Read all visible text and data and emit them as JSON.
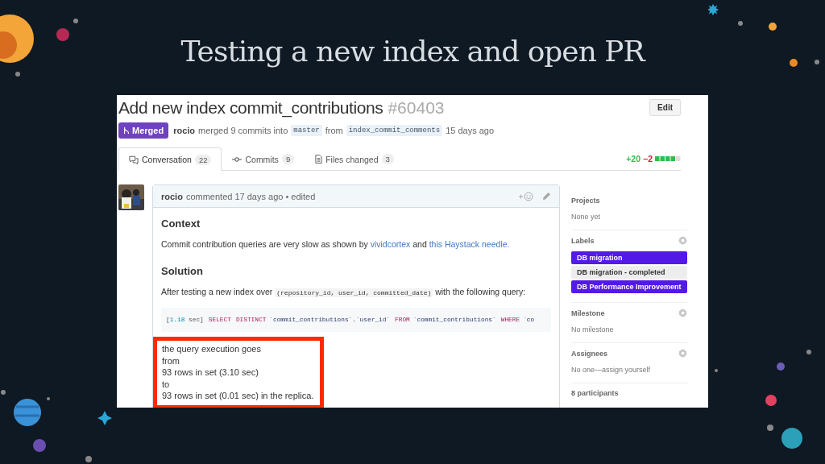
{
  "slide": {
    "title": "Testing a new index and open PR"
  },
  "pr": {
    "title": "Add new index commit_contributions",
    "number": "#60403",
    "state": "Merged",
    "edit": "Edit",
    "summary": [
      {
        "kind": "author",
        "text": "rocio"
      },
      {
        "kind": "text",
        "text": "merged 9 commits into"
      },
      {
        "kind": "branch",
        "text": "master"
      },
      {
        "kind": "text",
        "text": "from"
      },
      {
        "kind": "branch",
        "text": "index_commit_comments"
      },
      {
        "kind": "text",
        "text": "15 days ago"
      }
    ]
  },
  "tabs": [
    {
      "label": "Conversation",
      "count": "22",
      "selected": true
    },
    {
      "label": "Commits",
      "count": "9",
      "selected": false
    },
    {
      "label": "Files changed",
      "count": "3",
      "selected": false
    }
  ],
  "diffstat": {
    "added": "+20",
    "removed": "−2"
  },
  "comment": {
    "author": "rocio",
    "meta": "commented 17 days ago • edited",
    "blocks": [
      {
        "kind": "heading",
        "text": "Context"
      },
      {
        "kind": "paragraph",
        "parts": [
          {
            "kind": "text",
            "text": "Commit contribution queries are very slow as shown by "
          },
          {
            "kind": "link",
            "text": "vividcortex"
          },
          {
            "kind": "text",
            "text": " and "
          },
          {
            "kind": "link",
            "text": "this Haystack needle."
          }
        ]
      },
      {
        "kind": "heading",
        "text": "Solution"
      },
      {
        "kind": "paragraph",
        "parts": [
          {
            "kind": "text",
            "text": "After testing a new index over "
          },
          {
            "kind": "code",
            "text": "(repository_id, user_id, committed_date)"
          },
          {
            "kind": "text",
            "text": " with the following query:"
          }
        ]
      },
      {
        "kind": "code",
        "tokens": [
          {
            "kind": "plain",
            "text": "["
          },
          {
            "kind": "num",
            "text": "1.18"
          },
          {
            "kind": "plain",
            "text": " sec]"
          },
          {
            "kind": "kw",
            "text": "SELECT"
          },
          {
            "kind": "kw",
            "text": "DISTINCT"
          },
          {
            "kind": "ident",
            "text": "`commit_contributions`.`user_id`"
          },
          {
            "kind": "kw",
            "text": "FROM"
          },
          {
            "kind": "ident",
            "text": "`commit_contributions`"
          },
          {
            "kind": "kw",
            "text": "WHERE"
          },
          {
            "kind": "ident",
            "text": "`co"
          }
        ]
      },
      {
        "kind": "lines",
        "highlighted": true,
        "lines": [
          "the query execution goes",
          "from",
          "93 rows in set (3.10 sec)",
          "to",
          "93 rows in set (0.01 sec) in the replica."
        ]
      }
    ]
  },
  "sidebar": [
    {
      "kind": "field",
      "title": "Projects",
      "value": "None yet",
      "gear": false
    },
    {
      "kind": "labels",
      "title": "Labels",
      "gear": true,
      "labels": [
        {
          "name": "DB migration",
          "color": "#5319e7"
        },
        {
          "name": "DB migration - completed",
          "color": "#ededed"
        },
        {
          "name": "DB Performance Improvement",
          "color": "#5319e7"
        }
      ]
    },
    {
      "kind": "field",
      "title": "Milestone",
      "value": "No milestone",
      "gear": true
    },
    {
      "kind": "field",
      "title": "Assignees",
      "value": "No one—assign yourself",
      "gear": true
    },
    {
      "kind": "field",
      "title": "8 participants",
      "gear": false
    }
  ]
}
